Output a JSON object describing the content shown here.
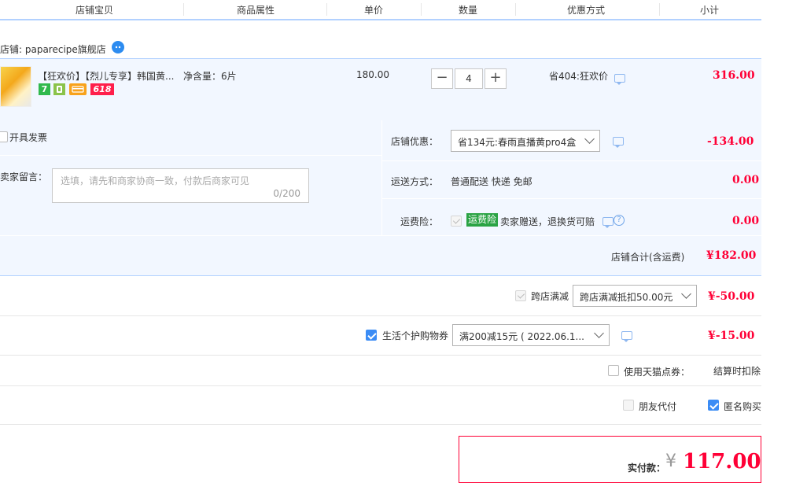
{
  "header": {
    "cols": [
      "店铺宝贝",
      "商品属性",
      "单价",
      "数量",
      "优惠方式",
      "小计"
    ]
  },
  "shop": {
    "label": "店铺: paparecipe旗舰店"
  },
  "item": {
    "title": "【狂欢价】【烈儿专享】韩国黄...",
    "attr": "净含量：6片",
    "unit_price": "180.00",
    "qty": "4",
    "promo": "省404:狂欢价",
    "subtotal": "316.00",
    "badge_618": "618",
    "badge_7": "7"
  },
  "invoice": {
    "label": "开具发票"
  },
  "message": {
    "label": "给卖家留言：",
    "placeholder": "选填，请先和商家协商一致，付款后商家可见",
    "counter": "0/200"
  },
  "shop_discount": {
    "label": "店铺优惠：",
    "selected": "省134元:春雨直播黄pro4盒",
    "amount": "-134.00"
  },
  "shipping": {
    "label": "运送方式：",
    "value": "普通配送 快递 免邮",
    "amount": "0.00"
  },
  "insurance": {
    "label": "运费险：",
    "tag": "运费险",
    "desc": "卖家赠送，退换货可赔",
    "help": "?",
    "amount": "0.00"
  },
  "shop_total": {
    "label": "店铺合计(含运费)",
    "amount": "¥182.00"
  },
  "cross_store": {
    "label": "跨店满减",
    "selected": "跨店满减抵扣50.00元",
    "amount": "¥-50.00"
  },
  "coupon": {
    "label": "生活个护购物券",
    "selected": "满200减15元 ( 2022.06.1...",
    "amount": "¥-15.00"
  },
  "tmall_points": {
    "label": "使用天猫点券：",
    "note": "结算时扣除"
  },
  "options": {
    "friend_pay": "朋友代付",
    "anonymous": "匿名购买"
  },
  "payment": {
    "label": "实付款：",
    "currency": "¥",
    "amount": "117.00"
  },
  "colors": {
    "price_red": "#ff0036",
    "blue_panel": "#f2f7ff",
    "checkbox_blue": "#3b8cf5",
    "header_border": "#b2d1ff",
    "insurance_green": "#2aa344"
  }
}
